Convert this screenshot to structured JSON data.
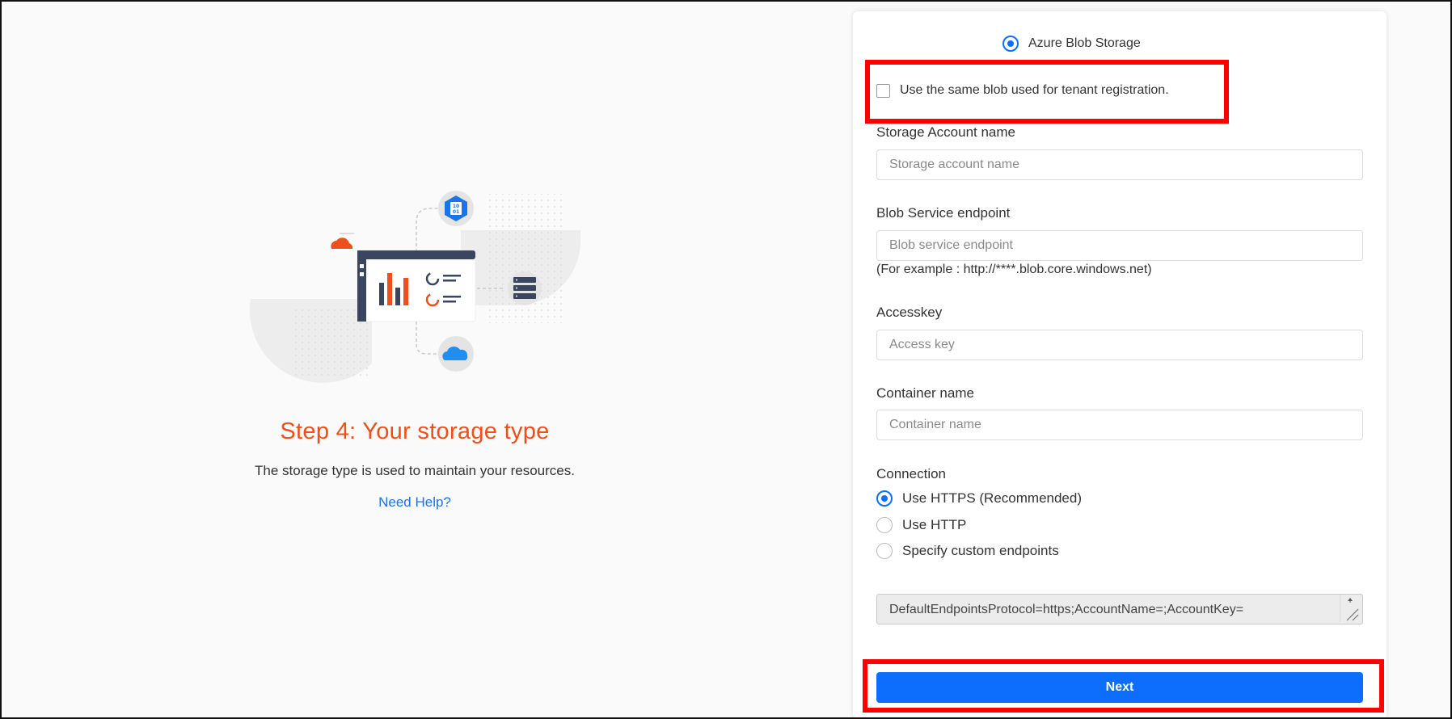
{
  "left": {
    "step_title": "Step 4: Your storage type",
    "description": "The storage type is used to maintain your resources.",
    "help_link": "Need Help?"
  },
  "form": {
    "storage_option": "Azure Blob Storage",
    "same_blob_checkbox": "Use the same blob used for tenant registration.",
    "storage_account": {
      "label": "Storage Account name",
      "placeholder": "Storage account name"
    },
    "blob_endpoint": {
      "label": "Blob Service endpoint",
      "placeholder": "Blob service endpoint",
      "hint": "(For example : http://****.blob.core.windows.net)"
    },
    "access_key": {
      "label": "Accesskey",
      "placeholder": "Access key"
    },
    "container": {
      "label": "Container name",
      "placeholder": "Container name"
    },
    "connection": {
      "label": "Connection",
      "options": [
        "Use HTTPS (Recommended)",
        "Use HTTP",
        "Specify custom endpoints"
      ],
      "selected": "Use HTTPS (Recommended)"
    },
    "connection_string": "DefaultEndpointsProtocol=https;AccountName=;AccountKey=",
    "next_label": "Next"
  },
  "colors": {
    "accent": "#0d6efd",
    "title": "#f04e1a",
    "highlight": "#ff0000",
    "link": "#1a73e8"
  }
}
